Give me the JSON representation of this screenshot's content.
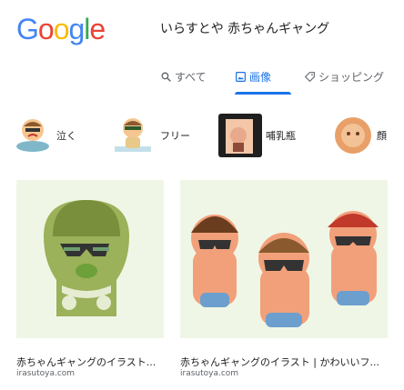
{
  "header": {
    "logo_letters": [
      {
        "ch": "G",
        "color": "#4285F4"
      },
      {
        "ch": "o",
        "color": "#EA4335"
      },
      {
        "ch": "o",
        "color": "#FBBC05"
      },
      {
        "ch": "g",
        "color": "#4285F4"
      },
      {
        "ch": "l",
        "color": "#34A853"
      },
      {
        "ch": "e",
        "color": "#EA4335"
      }
    ],
    "query": "いらすとや  赤ちゃんギャング"
  },
  "tabs": [
    {
      "label": "すべて",
      "icon": "search-icon",
      "active": false
    },
    {
      "label": "画像",
      "icon": "image-icon",
      "active": true
    },
    {
      "label": "ショッピング",
      "icon": "shopping-tag-icon",
      "active": false
    }
  ],
  "chips": [
    {
      "label": "泣く",
      "icon": "crying-baby-thumbnail"
    },
    {
      "label": "フリー",
      "icon": "baby-thumbnail"
    },
    {
      "label": "哺乳瓶",
      "icon": "photo-thumbnail"
    },
    {
      "label": "顔",
      "icon": "face-thumbnail"
    }
  ],
  "results": [
    {
      "title": "赤ちゃんギャングのイラスト...",
      "source": "irasutoya.com",
      "thumbnail": "single-baby-gang-illustration"
    },
    {
      "title": "赤ちゃんギャングのイラスト | かわいいフ...",
      "source": "irasutoya.com",
      "thumbnail": "three-baby-gang-illustration"
    }
  ],
  "colors": {
    "accent": "#1a73e8",
    "thumb_bg": "#eff6e6"
  }
}
